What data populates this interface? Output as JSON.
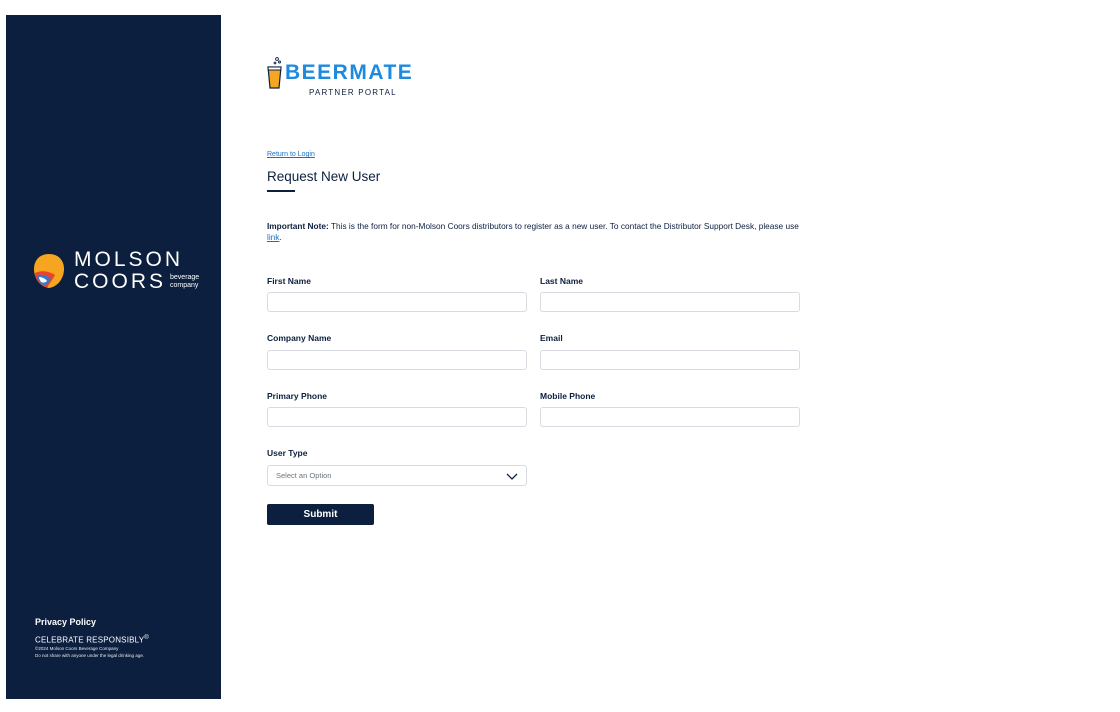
{
  "sidebar": {
    "logo": {
      "line1": "MOLSON",
      "line2": "COORS",
      "tag1": "beverage",
      "tag2": "company"
    },
    "privacy_label": "Privacy Policy",
    "celebrate": "CELEBRATE RESPONSIBLY",
    "celebrate_mark": "®",
    "copyright": "©2024 Molson Coors Beverage Company",
    "disclaimer": "Do not share with anyone under the legal drinking age."
  },
  "brand": {
    "name": "BEERMATE",
    "subtitle": "PARTNER PORTAL"
  },
  "page": {
    "return_link": "Return to Login",
    "title": "Request New User",
    "note_bold": "Important Note:",
    "note_text": " This is the form for non-Molson Coors distributors to register as a new user. To contact the Distributor Support Desk, please use ",
    "note_link": "link",
    "note_end": "."
  },
  "form": {
    "first_name": {
      "label": "First Name",
      "value": ""
    },
    "last_name": {
      "label": "Last Name",
      "value": ""
    },
    "company_name": {
      "label": "Company Name",
      "value": ""
    },
    "email": {
      "label": "Email",
      "value": ""
    },
    "primary_phone": {
      "label": "Primary Phone",
      "value": ""
    },
    "mobile_phone": {
      "label": "Mobile Phone",
      "value": ""
    },
    "user_type": {
      "label": "User Type",
      "placeholder": "Select an Option"
    },
    "submit_label": "Submit"
  },
  "colors": {
    "sidebar": "#0c1f3f",
    "brand_blue": "#1d8ae0",
    "link": "#1a6fc4",
    "accent_orange": "#f5a623"
  },
  "icons": {
    "brand": "beer-glass-icon",
    "molson": "molson-coors-mark-icon",
    "select": "chevron-down-icon"
  }
}
